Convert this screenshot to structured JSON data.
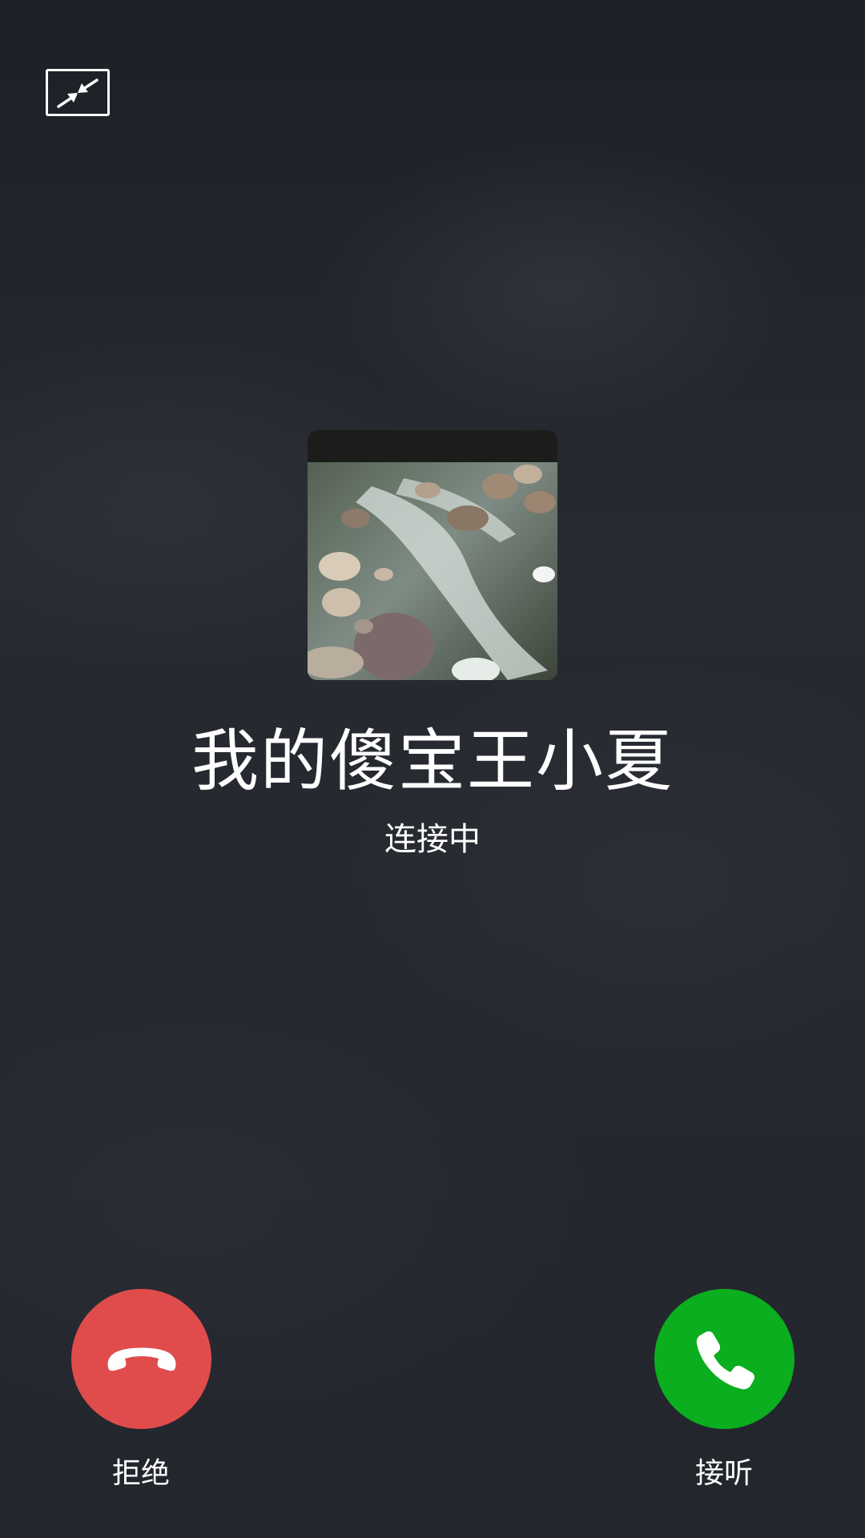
{
  "call": {
    "caller_name": "我的傻宝王小夏",
    "status": "连接中"
  },
  "actions": {
    "decline_label": "拒绝",
    "accept_label": "接听"
  },
  "icons": {
    "minimize": "minimize-icon",
    "decline": "phone-hangup-icon",
    "accept": "phone-answer-icon"
  },
  "colors": {
    "decline": "#e04c4c",
    "accept": "#0aae1e",
    "background": "#22252c"
  }
}
